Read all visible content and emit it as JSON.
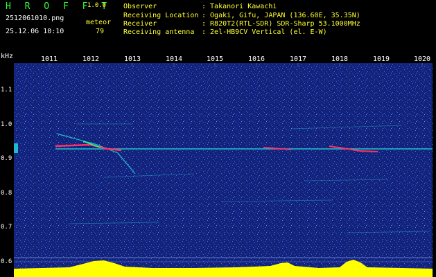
{
  "header": {
    "brand": "H R O F F T",
    "version": "1.0.0",
    "filename": "2512061010.png",
    "datetime": "25.12.06 10:10",
    "meteor_label": "meteor",
    "meteor_count": "79",
    "observer_label": "Observer",
    "observer_value": ": Takanori Kawachi",
    "location_label": "Receiving Location",
    "location_value": ": Ogaki, Gifu, JAPAN (136.60E, 35.35N)",
    "receiver_label": "Receiver",
    "receiver_value": ": R820T2(RTL-SDR) SDR-Sharp 53.1000MHz",
    "antenna_label": "Receiving antenna",
    "antenna_value": ": 2el-HB9CV Vertical (el. E-W)"
  },
  "axis": {
    "unit": "kHz",
    "x_ticks": [
      "1011",
      "1012",
      "1013",
      "1014",
      "1015",
      "1016",
      "1017",
      "1018",
      "1019",
      "1020"
    ],
    "y_ticks": [
      "1.1",
      "1.0",
      "0.9",
      "0.8",
      "0.7",
      "0.6"
    ]
  },
  "colors": {
    "noise_bg": "#1a2a88",
    "noise_dot": "#2b5bff",
    "carrier": "#22dddd",
    "echo": "#ff3366",
    "power": "#ffff00",
    "baseline": "#00c0ff"
  }
}
